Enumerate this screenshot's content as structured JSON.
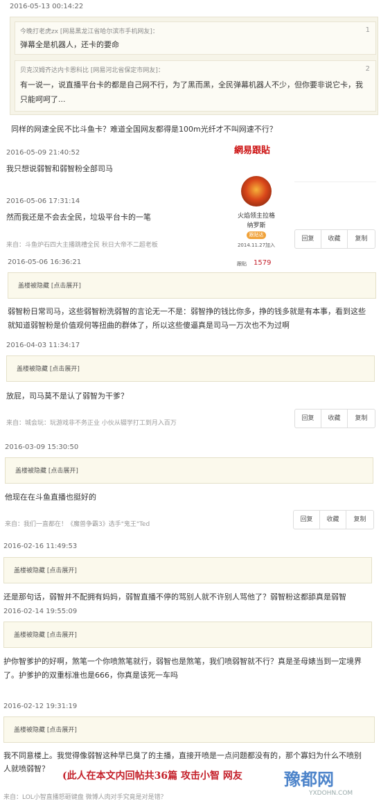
{
  "quote": {
    "top_timestamp": "2016-05-13 00:14:22",
    "floors": [
      {
        "header": "今晚打老虎zx [网易黑龙江省哈尔滨市手机网友]：",
        "floor": "1",
        "text_lines": [
          "弹幕全是机器人，还卡的要命"
        ]
      },
      {
        "header": "贝克汉姆齐达内卡恩科比 [网易河北省保定市网友]：",
        "floor": "2",
        "text_lines": [
          "有一说一，说直播平台卡的都是自己网不行，为了黑而黑，全民弹幕机器人不少，但你要非说它卡，我",
          "只能呵呵了..."
        ]
      }
    ],
    "reply": "同样的网速全民不比斗鱼卡？难道全国网友都得是100m光纤才不叫网速不行？"
  },
  "logo": "網易跟貼",
  "user_card": {
    "name_line1": "火焰领主拉格",
    "name_line2": "纳罗斯",
    "badge": "跟贴达",
    "joined": "2014.11.27加入",
    "label": "跟贴",
    "count": "1579"
  },
  "posts": [
    {
      "ts": "2016-05-09 21:40:52",
      "body": [
        "我只想说弱智和弱智粉全部司马"
      ]
    },
    {
      "ts": "2016-05-06 17:31:14",
      "body": [
        "然而我还是不会去全民，垃圾平台卡的一笔"
      ],
      "source": "来自：斗鱼炉石四大主播跳槽全民 秋日大帝不二超老板"
    },
    {
      "ts": "2016-05-06 16:36:21",
      "hidden": "盖楼被隐藏",
      "expand": "[点击展开]",
      "body": [
        "弱智粉日常司马，这些弱智粉洗弱智的言论无一不是：弱智挣的钱比你多，挣的钱多就是有本事，看到这些",
        "就知道弱智粉是价值观何等扭曲的群体了，所以这些傻逼真是司马一万次也不为过啊"
      ]
    },
    {
      "ts": "2016-04-03 11:34:17",
      "hidden": "盖楼被隐藏",
      "expand": "[点击展开]",
      "body": [
        "放屁，司马莫不是认了弱智为干爹？"
      ],
      "source": "来自：城会玩：玩游戏非不务正业 小伙从辍学打工到月入百万"
    },
    {
      "ts": "2016-03-09 15:30:50",
      "hidden": "盖楼被隐藏",
      "expand": "[点击展开]",
      "body": [
        "他现在在斗鱼直播也挺好的"
      ],
      "source": "来自：我们一直都在！《魔兽争霸3》选手\"鬼王\"Ted"
    },
    {
      "ts": "2016-02-16 11:49:53",
      "hidden": "盖楼被隐藏",
      "expand": "[点击展开]",
      "body": [
        "还是那句话，弱智并不配拥有妈妈，弱智直播不停的骂别人就不许别人骂他了？弱智粉这都舔真是弱智"
      ]
    },
    {
      "ts": "2016-02-14 19:55:09",
      "hidden": "盖楼被隐藏",
      "expand": "[点击展开]",
      "body": [
        "护你智爹护的好啊，煞笔一个你喷煞笔就行，弱智也是煞笔，我们喷弱智就不行？真是圣母婊当到一定境界",
        "了。护爹护的双重标准也是666，你真是该死一车吗"
      ]
    },
    {
      "ts": "2016-02-12 19:31:19",
      "hidden": "盖楼被隐藏",
      "expand": "[点击展开]",
      "body": [
        "我不同意楼上。我觉得像弱智这种早已臭了的主播，直接开喷是一点问题都没有的，那个寡妇为什么不喷别",
        "人就喷弱智？"
      ],
      "source": "来自：LOL小智直播怒砸键盘 微博人肉对手究竟是对是错？"
    }
  ],
  "buttons": {
    "reply": "回复",
    "favorite": "收藏",
    "copy": "复制"
  },
  "watermark": {
    "note": "(此人在本文内回帖共36篇 攻击小智 网友",
    "site": "豫都网",
    "url": "YXDOHN.COM"
  }
}
